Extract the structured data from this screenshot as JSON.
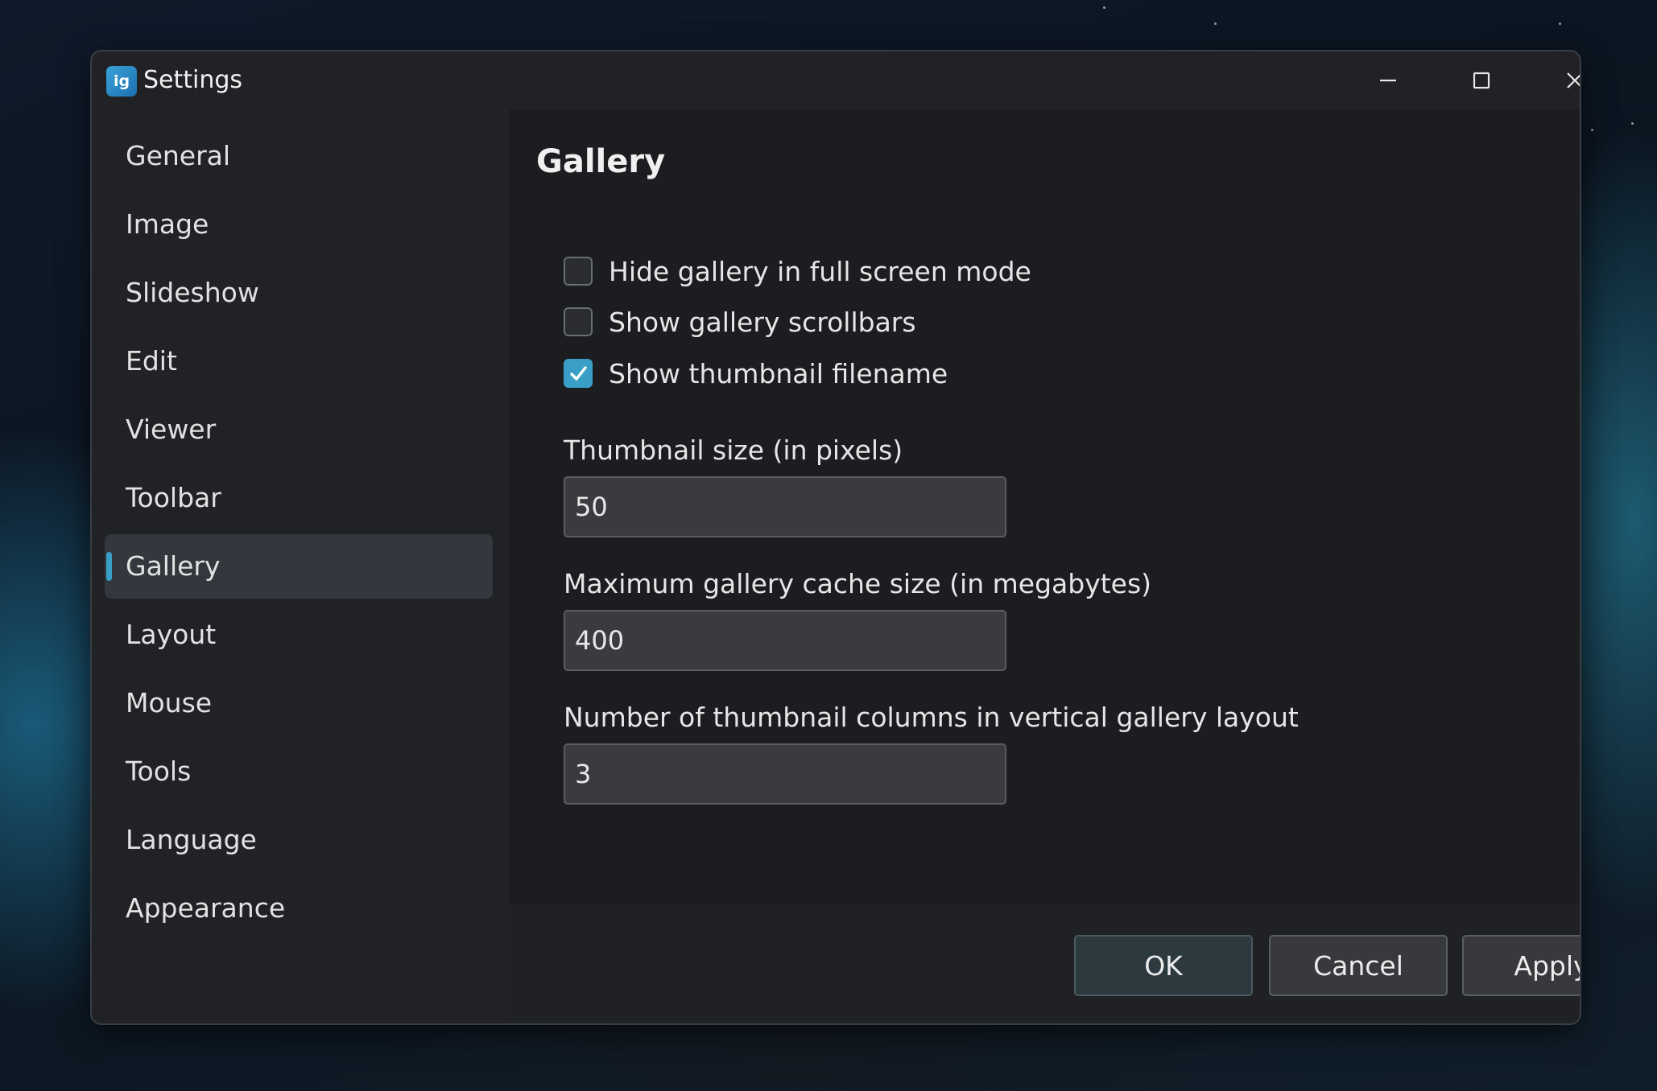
{
  "window": {
    "title": "Settings",
    "app_icon_text": "ig"
  },
  "sidebar": {
    "items": [
      {
        "label": "General"
      },
      {
        "label": "Image"
      },
      {
        "label": "Slideshow"
      },
      {
        "label": "Edit"
      },
      {
        "label": "Viewer"
      },
      {
        "label": "Toolbar"
      },
      {
        "label": "Gallery",
        "active": true
      },
      {
        "label": "Layout"
      },
      {
        "label": "Mouse"
      },
      {
        "label": "Tools"
      },
      {
        "label": "Language"
      },
      {
        "label": "Appearance"
      }
    ]
  },
  "gallery": {
    "title": "Gallery",
    "checkboxes": [
      {
        "label": "Hide gallery in full screen mode",
        "checked": false
      },
      {
        "label": "Show gallery scrollbars",
        "checked": false
      },
      {
        "label": "Show thumbnail filename",
        "checked": true
      }
    ],
    "fields": [
      {
        "label": "Thumbnail size (in pixels)",
        "value": "50"
      },
      {
        "label": "Maximum gallery cache size (in megabytes)",
        "value": "400"
      },
      {
        "label": "Number of thumbnail columns in vertical gallery layout",
        "value": "3"
      }
    ]
  },
  "footer": {
    "ok_label": "OK",
    "cancel_label": "Cancel",
    "apply_label": "Apply"
  },
  "colors": {
    "accent": "#3a9fc6",
    "window_bg": "#202226",
    "content_bg": "#1b1d20"
  }
}
